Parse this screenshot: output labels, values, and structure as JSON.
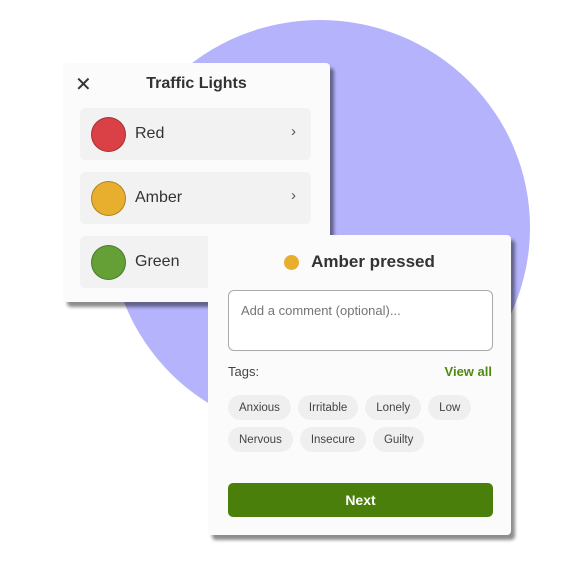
{
  "colors": {
    "background_circle": "#b4b3fb",
    "red": "#d94146",
    "amber": "#e8ae2e",
    "green": "#64a035",
    "primary": "#4a7f0c"
  },
  "traffic_lights": {
    "title": "Traffic Lights",
    "close_icon": "close-icon",
    "items": [
      {
        "label": "Red",
        "color": "#d94146"
      },
      {
        "label": "Amber",
        "color": "#e8ae2e"
      },
      {
        "label": "Green",
        "color": "#64a035"
      }
    ]
  },
  "dialog": {
    "title": "Amber pressed",
    "comment_placeholder": "Add a comment (optional)...",
    "tags_label": "Tags:",
    "view_all": "View all",
    "tags": [
      "Anxious",
      "Irritable",
      "Lonely",
      "Low",
      "Nervous",
      "Insecure",
      "Guilty"
    ],
    "next_label": "Next"
  }
}
